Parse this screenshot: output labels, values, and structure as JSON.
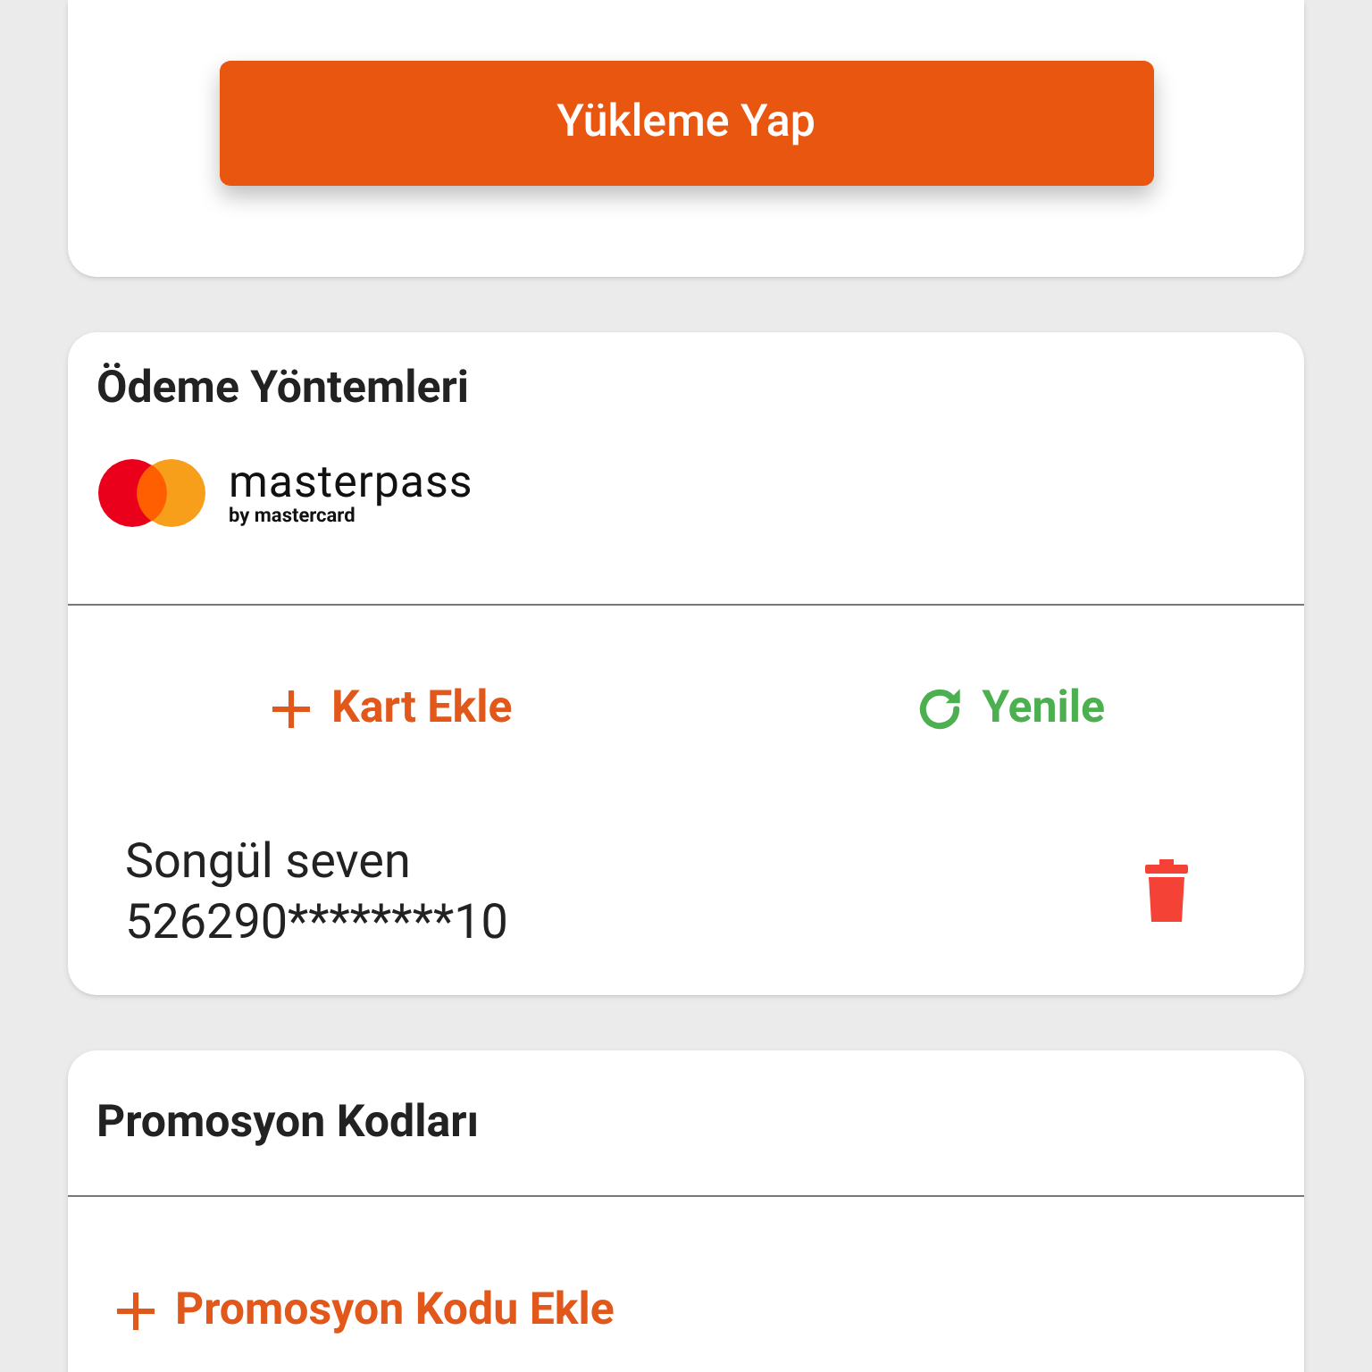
{
  "top_up": {
    "button": "Yükleme Yap"
  },
  "payment_methods": {
    "title": "Ödeme Yöntemleri",
    "logo": {
      "wordmark": "masterpass",
      "byline": "by mastercard"
    },
    "actions": [
      {
        "kind": "add",
        "label": "Kart Ekle"
      },
      {
        "kind": "refresh",
        "label": "Yenile"
      }
    ],
    "cards": [
      {
        "holder": "Songül seven",
        "number": "526290********10"
      }
    ]
  },
  "promo_codes": {
    "title": "Promosyon Kodları",
    "action": {
      "kind": "add",
      "label": "Promosyon Kodu Ekle"
    }
  }
}
